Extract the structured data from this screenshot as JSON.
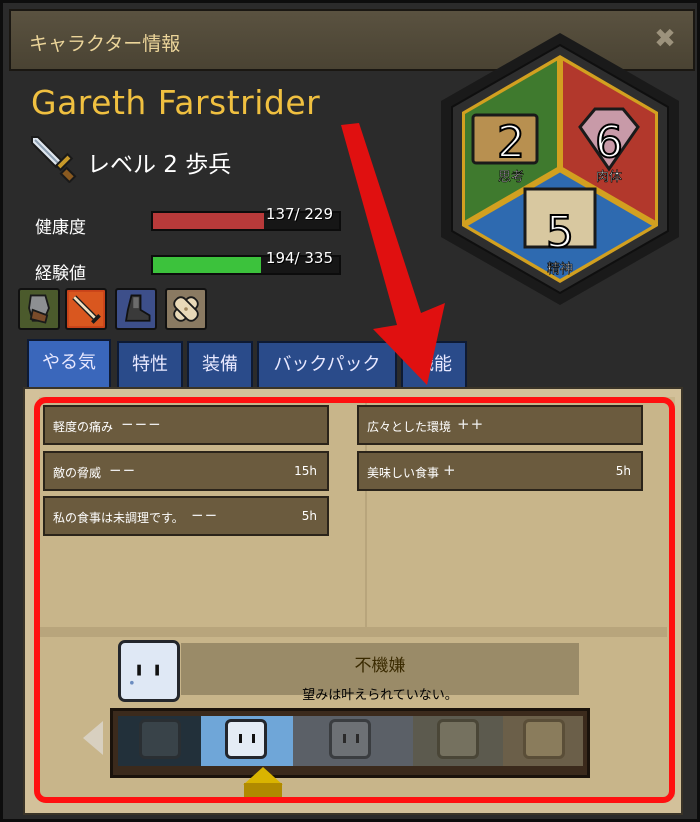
{
  "window": {
    "title": "キャラクター情報",
    "close_glyph": "✖"
  },
  "character": {
    "name": "Gareth Farstrider",
    "class_line": "レベル 2 歩兵"
  },
  "stats": [
    {
      "label": "健康度",
      "value_text": "137/ 229",
      "current": 137,
      "max": 229,
      "color": "#b83a3a"
    },
    {
      "label": "経験値",
      "value_text": "194/ 335",
      "current": 194,
      "max": 335,
      "color": "#3cc23c"
    }
  ],
  "trait_icons": [
    "leg-armor-icon",
    "sword-burst-icon",
    "boot-icon",
    "bandage-icon"
  ],
  "attributes": [
    {
      "value": "2",
      "label": "思考",
      "icon": "book-icon"
    },
    {
      "value": "6",
      "label": "肉体",
      "icon": "gem-icon"
    },
    {
      "value": "5",
      "label": "精神",
      "icon": "scroll-icon"
    }
  ],
  "tabs": [
    {
      "label": "やる気",
      "active": true
    },
    {
      "label": "特性",
      "active": false
    },
    {
      "label": "装備",
      "active": false
    },
    {
      "label": "バックパック",
      "active": false
    },
    {
      "label": "職能",
      "active": false
    }
  ],
  "moodlets_left": [
    {
      "label": "軽度の痛み",
      "effect": "−−−",
      "duration": ""
    },
    {
      "label": "敵の脅威",
      "effect": "−−",
      "duration": "15h"
    },
    {
      "label": "私の食事は未調理です。",
      "effect": "−−",
      "duration": "5h"
    }
  ],
  "moodlets_right": [
    {
      "label": "広々とした環境",
      "effect": "++",
      "duration": ""
    },
    {
      "label": "美味しい食事",
      "effect": "+",
      "duration": "5h"
    }
  ],
  "mood": {
    "name": "不機嫌",
    "description": "望みは叶えられていない。"
  },
  "colors": {
    "highlight": "#ff1010",
    "tab_active": "#3a67bb",
    "tab_inactive": "#2a4b8a",
    "name_gold": "#f0c040"
  }
}
